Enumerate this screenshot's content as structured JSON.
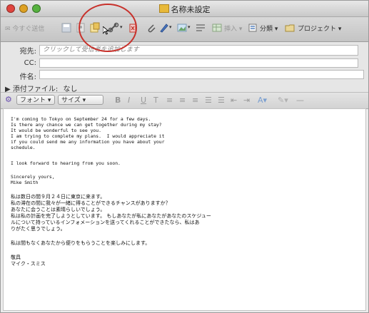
{
  "window": {
    "title": "名称未設定"
  },
  "toolbar": {
    "send_now": "今すぐ送信",
    "insert": "挿入",
    "category": "分類",
    "project": "プロジェクト"
  },
  "header": {
    "to_label": "宛先:",
    "to_placeholder": "クリックして受信者を追加します",
    "cc_label": "CC:",
    "subject_label": "件名:",
    "attachments_label": "添付ファイル:",
    "attachments_value": "なし"
  },
  "format_bar": {
    "font_button": "フォント",
    "size_button": "サイズ"
  },
  "body_lines": [
    "I'm coming to Tokyo on September 24 for a few days.",
    "Is there any chance we can get together during my stay?",
    "It would be wonderful to see you.",
    "I am trying to complete my plans.  I would appreciate it",
    "if you could send me any information you have about your",
    "schedule.",
    "",
    "I look forward to hearing from you soon.",
    "",
    "Sincerely yours,",
    "Mike Smith",
    "",
    "私は数日の間９月２４日に東京に来ます。",
    "私の滞在の間に我々が一緒に得ることができるチャンスがありますか？",
    "あなたに会うことは素晴らしいでしょう。",
    "私は私の計画を完了しようとしています。 もしあなたが私にあなたがあなたのスケジュー",
    "ルについて持っているインフォメーションを送ってくれることができたなら、私はあ",
    "りがたく思うでしょう。",
    "",
    "私は間もなくあなたから便りをもらうことを楽しみにします。",
    "",
    "敬具",
    "マイク・スミス"
  ],
  "colors": {
    "annotation_circle": "#c8312b"
  }
}
